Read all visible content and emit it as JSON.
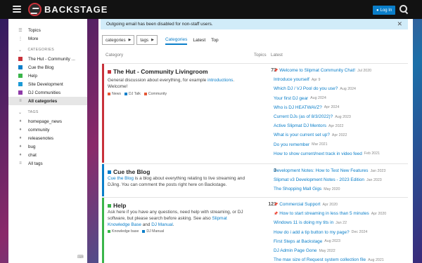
{
  "header": {
    "title": "BACKSTAGE",
    "login_label": "Log In"
  },
  "alert": {
    "text": "Outgoing email has been disabled for non-staff users."
  },
  "sidebar": {
    "top_items": [
      {
        "label": "Topics",
        "icon": "layers-icon"
      },
      {
        "label": "More",
        "icon": "vertical-dots-icon"
      }
    ],
    "categories_title": "CATEGORIES",
    "categories": [
      {
        "label": "The Hut - Community ...",
        "color": "#c8313a"
      },
      {
        "label": "Cue the Blog",
        "color": "#0a7ec9"
      },
      {
        "label": "Help",
        "color": "#3ab54a"
      },
      {
        "label": "Site Development",
        "color": "#1c9ad6"
      },
      {
        "label": "DJ Communities",
        "color": "#8e3aa8"
      }
    ],
    "all_categories": "All categories",
    "tags_title": "TAGS",
    "tags": [
      "homepage_news",
      "community",
      "releasenotes",
      "bug",
      "chat"
    ],
    "all_tags": "All tags"
  },
  "nav": {
    "categories_dd": "categories",
    "tags_dd": "tags",
    "tabs": [
      "Categories",
      "Latest",
      "Top"
    ]
  },
  "table": {
    "col_category": "Category",
    "col_topics": "Topics",
    "col_latest": "Latest"
  },
  "categories": [
    {
      "title": "The Hut - Community Livingroom",
      "color": "#c8313a",
      "desc_pre": "General discussion about everything, for example ",
      "desc_link": "introductions",
      "desc_post": ". Welcome!",
      "subs": [
        {
          "label": "News",
          "color": "#e45735"
        },
        {
          "label": "DJ Talk",
          "color": "#0a7ec9"
        },
        {
          "label": "Community",
          "color": "#e45735"
        }
      ],
      "topics": "73",
      "latest": [
        {
          "title": "Welcome to Slipmat Community Chat!",
          "date": "Jul 2020",
          "pinned": true
        },
        {
          "title": "Introduce yourself",
          "date": "Apr 9",
          "pinned": false
        },
        {
          "title": "Which DJ / VJ Pool do you use?",
          "date": "Aug 2024",
          "pinned": false
        },
        {
          "title": "Your first DJ gear",
          "date": "Aug 2024",
          "pinned": false
        },
        {
          "title": "Who is DJ HEATWAVZ?",
          "date": "Apr 2024",
          "pinned": false
        },
        {
          "title": "Current DJs (as of 8/3/2022)?",
          "date": "Aug 2023",
          "pinned": false
        },
        {
          "title": "Active Slipmat DJ Mentors",
          "date": "Apr 2022",
          "pinned": false
        },
        {
          "title": "What is your current set up?",
          "date": "Apr 2022",
          "pinned": false
        },
        {
          "title": "Do you remember",
          "date": "Mar 2021",
          "pinned": false
        },
        {
          "title": "How to show current/next track in video feed",
          "date": "Feb 2021",
          "pinned": false
        }
      ]
    },
    {
      "title": "Cue the Blog",
      "color": "#0a7ec9",
      "desc_link": "Cue the Blog",
      "desc_post": " is a blog about everything relating to live streaming and DJing. You can comment the posts right here on Backstage.",
      "topics": "3",
      "latest": [
        {
          "title": "Development Notes: How to Test New Features",
          "date": "Jan 2023",
          "pinned": false
        },
        {
          "title": "Slipmat v3 Development Notes - 2023 Edition",
          "date": "Jan 2023",
          "pinned": false
        },
        {
          "title": "The Shopping Mall Gigs",
          "date": "May 2020",
          "pinned": false
        }
      ]
    },
    {
      "title": "Help",
      "color": "#3ab54a",
      "desc_pre": "Ask here if you have any questions, need help with streaming, or DJ software, but please search before asking. See also ",
      "desc_link1": "Slipmat Knowledge Base",
      "desc_mid": " and ",
      "desc_link2": "DJ Manual",
      "desc_post": ".",
      "subs": [
        {
          "label": "Knowledge base",
          "color": "#3ab54a"
        },
        {
          "label": "DJ Manual",
          "color": "#0a7ec9"
        }
      ],
      "topics": "121",
      "latest": [
        {
          "title": "Commercial Support",
          "date": "Apr 2020",
          "pinned": true
        },
        {
          "title": "How to start streaming in less than 5 minutes",
          "date": "Apr 2020",
          "pinned": true
        },
        {
          "title": "Windows 11 is doing my tits in",
          "date": "Jan 22",
          "pinned": false
        },
        {
          "title": "How do i add a tip button to my page?",
          "date": "Dec 2024",
          "pinned": false
        },
        {
          "title": "First Steps at Backstage",
          "date": "Aug 2023",
          "pinned": false
        },
        {
          "title": "DJ Admin Page Gone",
          "date": "May 2022",
          "pinned": false
        },
        {
          "title": "The max size of Request system collection file",
          "date": "Aug 2021",
          "pinned": false
        }
      ]
    }
  ]
}
